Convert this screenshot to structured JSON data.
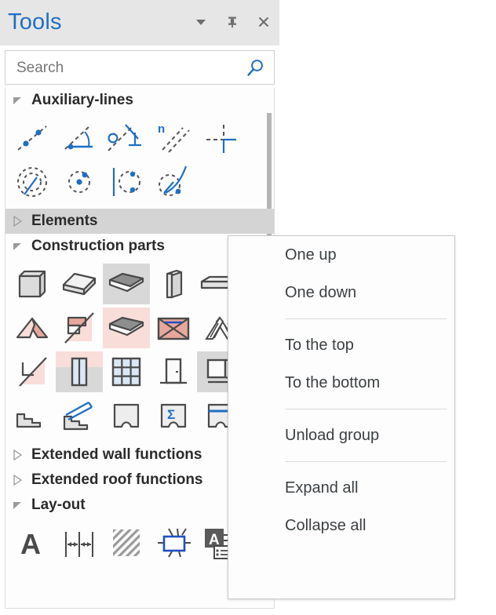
{
  "panel": {
    "title": "Tools",
    "titlebar_buttons": [
      {
        "name": "dropdown-icon",
        "label": "Dropdown"
      },
      {
        "name": "pin-icon",
        "label": "Pin"
      },
      {
        "name": "close-icon",
        "label": "Close"
      }
    ],
    "search": {
      "placeholder": "Search",
      "value": "",
      "icon": "search-icon"
    },
    "groups": [
      {
        "label": "Auxiliary-lines",
        "expanded": true,
        "highlighted": false,
        "rows": [
          [
            {
              "icon": "auxline-two-points-icon"
            },
            {
              "icon": "auxline-angle-icon"
            },
            {
              "icon": "auxline-perpendicular-icon"
            },
            {
              "icon": "auxline-parallel-n-icon"
            },
            {
              "icon": "auxline-crosshair-icon"
            }
          ],
          [
            {
              "icon": "auxcircle-concentric-icon"
            },
            {
              "icon": "auxcircle-center-point-icon"
            },
            {
              "icon": "auxcircle-tangent-line-icon"
            },
            {
              "icon": "auxcircle-arc-icon"
            }
          ]
        ]
      },
      {
        "label": "Elements",
        "expanded": false,
        "highlighted": true,
        "rows": []
      },
      {
        "label": "Construction parts",
        "expanded": true,
        "highlighted": false,
        "rows": [
          [
            {
              "icon": "wall-icon",
              "selected": "none"
            },
            {
              "icon": "slab-icon",
              "selected": "none"
            },
            {
              "icon": "floor-slab-icon",
              "selected": "gray"
            },
            {
              "icon": "column-icon",
              "selected": "none"
            },
            {
              "icon": "beam-icon",
              "selected": "none"
            }
          ],
          [
            {
              "icon": "gable-roof-icon",
              "selected": "none"
            },
            {
              "icon": "shed-roof-icon",
              "selected": "none"
            },
            {
              "icon": "roof-slab-icon",
              "selected": "pink"
            },
            {
              "icon": "hip-roof-icon",
              "selected": "none"
            },
            {
              "icon": "roof-rafters-icon",
              "selected": "none"
            }
          ],
          [
            {
              "icon": "dormer-icon",
              "selected": "none"
            },
            {
              "icon": "window-icon",
              "selected": "pinkgray"
            },
            {
              "icon": "window-grid-icon",
              "selected": "none"
            },
            {
              "icon": "door-icon",
              "selected": "none"
            },
            {
              "icon": "wall-opening-icon",
              "selected": "gray"
            }
          ],
          [
            {
              "icon": "stairs-icon",
              "selected": "none"
            },
            {
              "icon": "stairs-railing-icon",
              "selected": "none"
            },
            {
              "icon": "arch-opening-icon",
              "selected": "none"
            },
            {
              "icon": "arch-sum-icon",
              "selected": "none"
            },
            {
              "icon": "arch-lintel-icon",
              "selected": "none"
            }
          ]
        ]
      },
      {
        "label": "Extended wall functions",
        "expanded": false,
        "highlighted": false,
        "rows": []
      },
      {
        "label": "Extended roof functions",
        "expanded": false,
        "highlighted": false,
        "rows": []
      },
      {
        "label": "Lay-out",
        "expanded": true,
        "highlighted": false,
        "rows": [
          [
            {
              "icon": "text-a-icon"
            },
            {
              "icon": "dimension-icon"
            },
            {
              "icon": "hatch-icon"
            },
            {
              "icon": "label-frame-icon"
            },
            {
              "icon": "text-box-icon"
            }
          ]
        ]
      }
    ]
  },
  "context_menu": {
    "items": [
      {
        "label": "One up",
        "separator_after": false
      },
      {
        "label": "One down",
        "separator_after": true
      },
      {
        "label": "To the top",
        "separator_after": false
      },
      {
        "label": "To the bottom",
        "separator_after": true
      },
      {
        "label": "Unload group",
        "separator_after": true
      },
      {
        "label": "Expand all",
        "separator_after": false
      },
      {
        "label": "Collapse all",
        "separator_after": false
      }
    ]
  },
  "colors": {
    "accent_blue": "#1f6fc4",
    "titlebar_bg": "#e6e6e6",
    "header_highlight": "#d4d4d4",
    "icon_gray": "#4a4a4a",
    "icon_pink": "#e8a79c",
    "icon_pink_light": "#f8ddd8",
    "panel_bg": "#fdfdfd"
  }
}
